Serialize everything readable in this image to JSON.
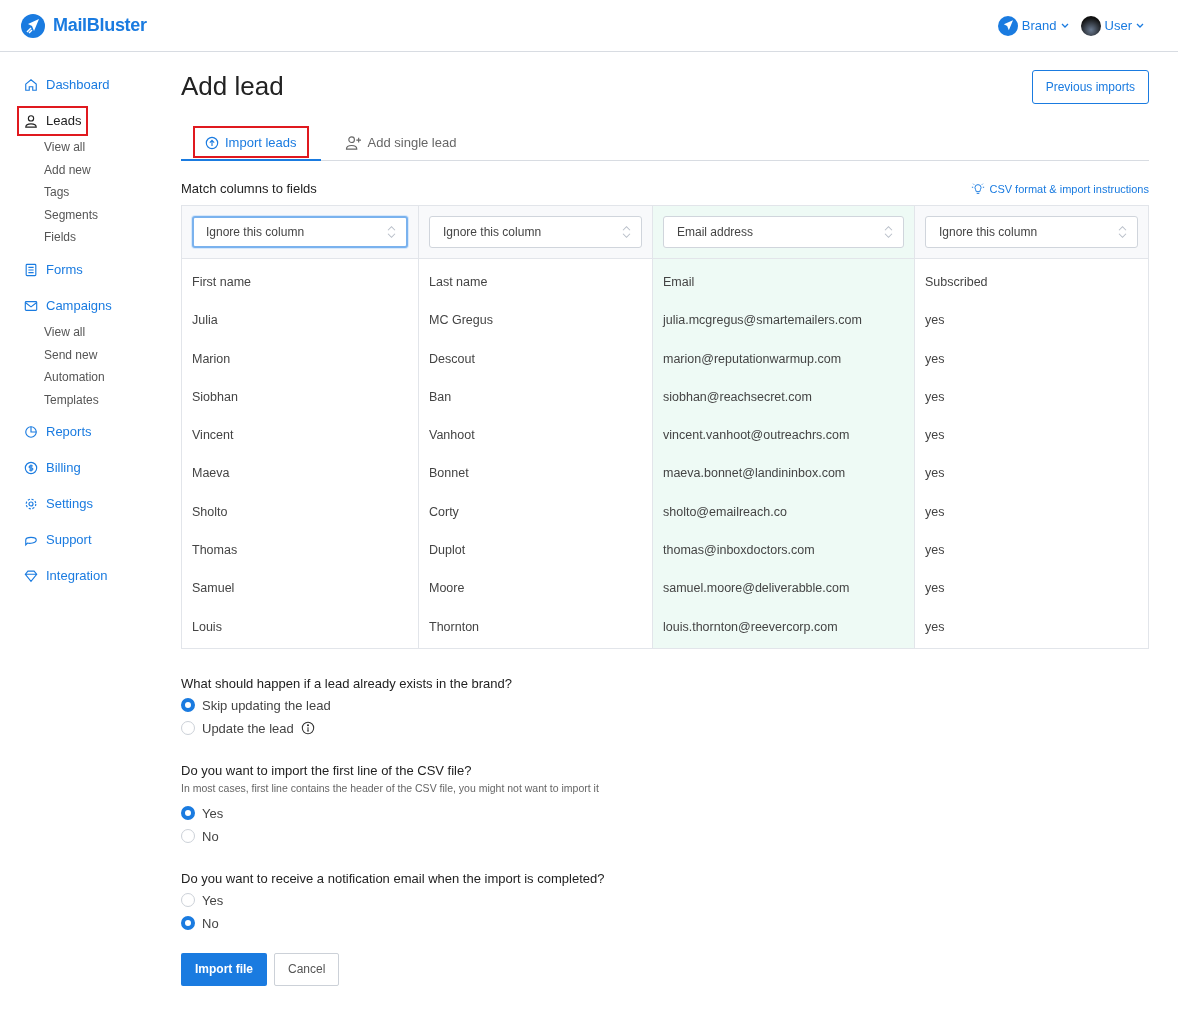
{
  "header": {
    "logo": "MailBluster",
    "brand_menu": "Brand",
    "user_menu": "User"
  },
  "sidebar": {
    "items": [
      {
        "label": "Dashboard",
        "selected": false,
        "highlighted": false
      },
      {
        "label": "Leads",
        "selected": true,
        "highlighted": true,
        "children": [
          {
            "label": "View all"
          },
          {
            "label": "Add new"
          },
          {
            "label": "Tags"
          },
          {
            "label": "Segments"
          },
          {
            "label": "Fields"
          }
        ]
      },
      {
        "label": "Forms",
        "selected": false,
        "highlighted": false
      },
      {
        "label": "Campaigns",
        "selected": false,
        "highlighted": false,
        "children": [
          {
            "label": "View all"
          },
          {
            "label": "Send new"
          },
          {
            "label": "Automation"
          },
          {
            "label": "Templates"
          }
        ]
      },
      {
        "label": "Reports",
        "selected": false,
        "highlighted": false
      },
      {
        "label": "Billing",
        "selected": false,
        "highlighted": false
      },
      {
        "label": "Settings",
        "selected": false,
        "highlighted": false
      },
      {
        "label": "Support",
        "selected": false,
        "highlighted": false
      },
      {
        "label": "Integration",
        "selected": false,
        "highlighted": false
      }
    ]
  },
  "page": {
    "title": "Add lead",
    "previous_imports": "Previous imports"
  },
  "tabs": [
    {
      "label": "Import leads",
      "selected": true,
      "highlighted": true
    },
    {
      "label": "Add single lead",
      "selected": false,
      "highlighted": false
    }
  ],
  "match": {
    "heading": "Match columns to fields",
    "instructions_link": "CSV format & import instructions"
  },
  "table": {
    "columns": [
      {
        "field": "Ignore this column",
        "focused": true,
        "matched": false
      },
      {
        "field": "Ignore this column",
        "focused": false,
        "matched": false
      },
      {
        "field": "Email address",
        "focused": false,
        "matched": true
      },
      {
        "field": "Ignore this column",
        "focused": false,
        "matched": false
      }
    ],
    "rows": [
      [
        "First name",
        "Last name",
        "Email",
        "Subscribed"
      ],
      [
        "Julia",
        "MC Gregus",
        "julia.mcgregus@smartemailers.com",
        "yes"
      ],
      [
        "Marion",
        "Descout",
        "marion@reputationwarmup.com",
        "yes"
      ],
      [
        "Siobhan",
        "Ban",
        "siobhan@reachsecret.com",
        "yes"
      ],
      [
        "Vincent",
        "Vanhoot",
        "vincent.vanhoot@outreachrs.com",
        "yes"
      ],
      [
        "Maeva",
        "Bonnet",
        "maeva.bonnet@landininbox.com",
        "yes"
      ],
      [
        "Sholto",
        "Corty",
        "sholto@emailreach.co",
        "yes"
      ],
      [
        "Thomas",
        "Duplot",
        "thomas@inboxdoctors.com",
        "yes"
      ],
      [
        "Samuel",
        "Moore",
        "samuel.moore@deliverabble.com",
        "yes"
      ],
      [
        "Louis",
        "Thornton",
        "louis.thornton@reevercorp.com",
        "yes"
      ]
    ]
  },
  "questions": [
    {
      "question": "What should happen if a lead already exists in the brand?",
      "options": [
        {
          "label": "Skip updating the lead",
          "selected": true,
          "info": false
        },
        {
          "label": "Update the lead",
          "selected": false,
          "info": true
        }
      ]
    },
    {
      "question": "Do you want to import the first line of the CSV file?",
      "hint": "In most cases, first line contains the header of the CSV file, you might not want to import it",
      "options": [
        {
          "label": "Yes",
          "selected": true
        },
        {
          "label": "No",
          "selected": false
        }
      ]
    },
    {
      "question": "Do you want to receive a notification email when the import is completed?",
      "options": [
        {
          "label": "Yes",
          "selected": false
        },
        {
          "label": "No",
          "selected": true
        }
      ]
    }
  ],
  "actions": {
    "primary": "Import file",
    "secondary": "Cancel"
  }
}
